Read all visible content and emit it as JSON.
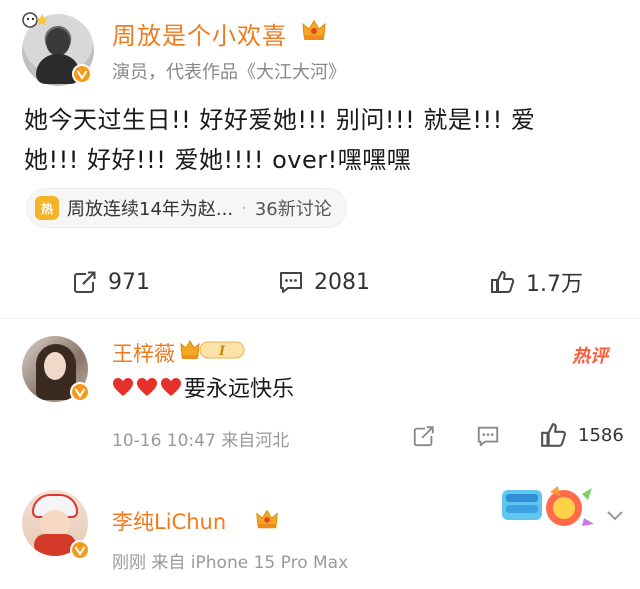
{
  "post": {
    "author_name": "周放是个小欢喜",
    "author_subtitle": "演员，代表作品《大江大河》",
    "text_line1": "她今天过生日!! 好好爱她!!! 别问!!! 就是!!! 爱",
    "text_line2": "她!!! 好好!!! 爱她!!!! over!嘿嘿嘿",
    "topic": {
      "icon_text": "热",
      "label": "周放连续14年为赵...",
      "separator": "·",
      "discussions": "36新讨论"
    },
    "actions": {
      "share_count": "971",
      "comment_count": "2081",
      "like_count": "1.7万"
    }
  },
  "comments": [
    {
      "name": "王梓薇",
      "level": "I",
      "hot_tag": "热评",
      "text": "要永远快乐",
      "hearts": 3,
      "meta": "10-16 10:47  来自河北",
      "like_count": "1586"
    },
    {
      "name": "李纯LiChun",
      "meta": "刚刚  来自 iPhone 15 Pro Max"
    }
  ],
  "colors": {
    "accent_orange": "#f07a1e",
    "verify_badge": "#f39a1a",
    "hot_red": "#ff5a3c",
    "heart_red": "#e8302b",
    "meta_gray": "#999999"
  },
  "icons": [
    "share-icon",
    "comment-icon",
    "like-icon",
    "crown-icon",
    "verified-icon",
    "heart-icon",
    "chevron-down-icon"
  ]
}
